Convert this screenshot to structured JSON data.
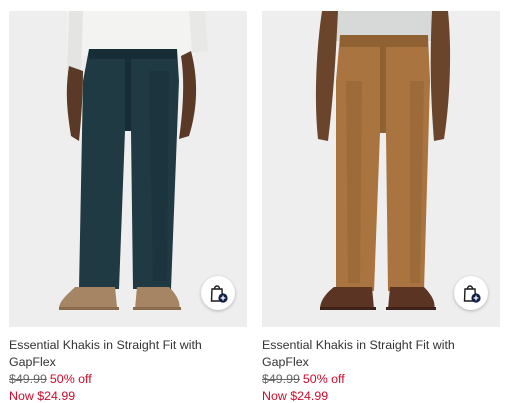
{
  "products": [
    {
      "title": "Essential Khakis in Straight Fit with GapFlex",
      "original_price": "$49.99",
      "discount": "50% off",
      "sale_price": "Now $24.99",
      "pant_color": "#203a44",
      "pant_shade": "#172d35",
      "shirt_color": "#f3f3f1",
      "shoe_color": "#a58563",
      "skin_color": "#5a3a26",
      "background": "#eeeeee",
      "icons": [
        "add-to-bag-icon"
      ]
    },
    {
      "title": "Essential Khakis in Straight Fit with GapFlex",
      "original_price": "$49.99",
      "discount": "50% off",
      "sale_price": "Now $24.99",
      "pant_color": "#a9743f",
      "pant_shade": "#8f6133",
      "shirt_color": "#d7d9d8",
      "shoe_color": "#5c3424",
      "skin_color": "#6a452c",
      "background": "#eeeeee",
      "icons": [
        "add-to-bag-icon"
      ]
    }
  ],
  "accent_colors": {
    "sale_red": "#d00a2c",
    "bag_icon_badge": "#0d1f45"
  }
}
